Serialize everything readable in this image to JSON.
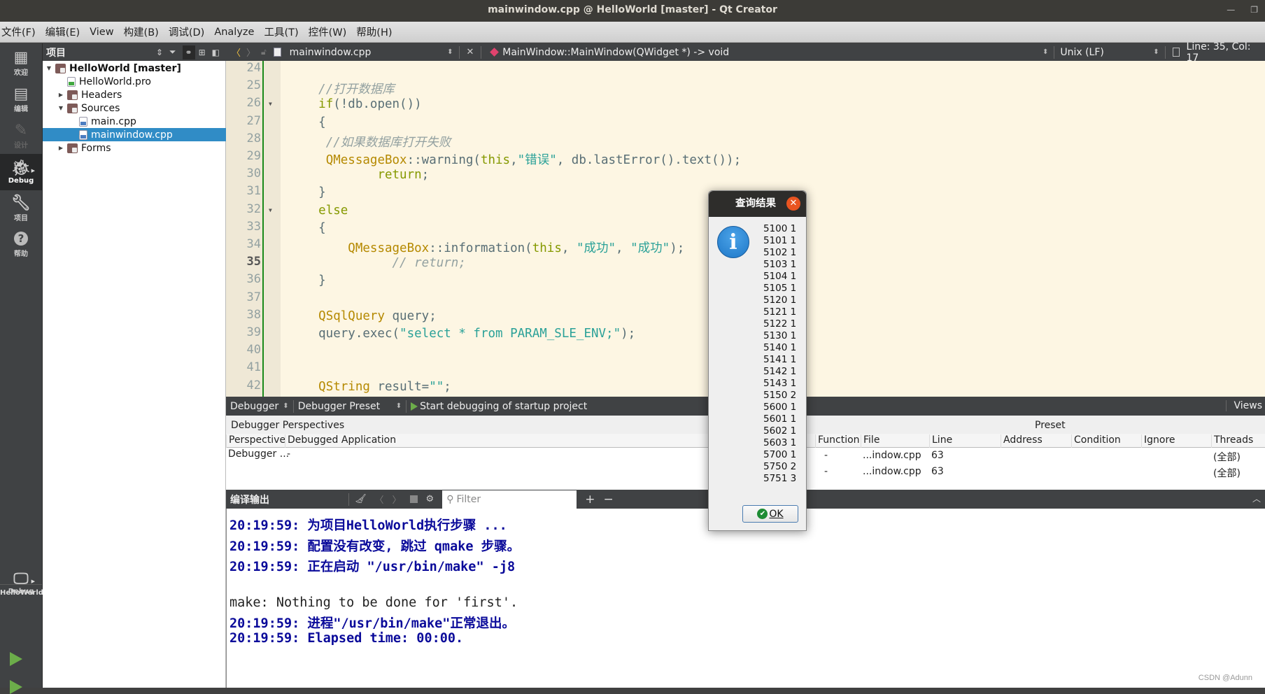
{
  "window": {
    "title": "mainwindow.cpp @ HelloWorld [master] - Qt Creator",
    "minimize_icon": "minimize-icon",
    "restore_icon": "restore-icon"
  },
  "menubar": {
    "items": [
      {
        "label": "文件(F)"
      },
      {
        "label": "编辑(E)"
      },
      {
        "label": "View"
      },
      {
        "label": "构建(B)"
      },
      {
        "label": "调试(D)"
      },
      {
        "label": "Analyze"
      },
      {
        "label": "工具(T)"
      },
      {
        "label": "控件(W)"
      },
      {
        "label": "帮助(H)"
      }
    ]
  },
  "modebar": {
    "modes": [
      {
        "label": "欢迎",
        "icon": "grid-icon",
        "state": "normal"
      },
      {
        "label": "编辑",
        "icon": "edit-doc-icon",
        "state": "normal"
      },
      {
        "label": "设计",
        "icon": "pencil-icon",
        "state": "disabled"
      },
      {
        "label": "Debug",
        "icon": "bug-icon",
        "state": "active"
      },
      {
        "label": "项目",
        "icon": "wrench-icon",
        "state": "normal"
      },
      {
        "label": "帮助",
        "icon": "help-icon",
        "state": "normal"
      }
    ],
    "kit_project": "HelloWorld",
    "kit_config": "Debug"
  },
  "project_panel": {
    "title": "项目",
    "tree": [
      {
        "label": "HelloWorld [master]",
        "level": 0,
        "expanded": true,
        "type": "project",
        "bold": true
      },
      {
        "label": "HelloWorld.pro",
        "level": 1,
        "type": "pro-file"
      },
      {
        "label": "Headers",
        "level": 1,
        "expanded": false,
        "type": "folder"
      },
      {
        "label": "Sources",
        "level": 1,
        "expanded": true,
        "type": "folder"
      },
      {
        "label": "main.cpp",
        "level": 2,
        "type": "cpp-file"
      },
      {
        "label": "mainwindow.cpp",
        "level": 2,
        "type": "cpp-file",
        "selected": true
      },
      {
        "label": "Forms",
        "level": 1,
        "expanded": false,
        "type": "folder"
      }
    ]
  },
  "editor_toolbar": {
    "file": "mainwindow.cpp",
    "function": "MainWindow::MainWindow(QWidget *) -> void",
    "line_ending": "Unix (LF)",
    "cursor": "Line: 35, Col: 17"
  },
  "editor": {
    "current_line": 35,
    "lines": [
      {
        "n": "24",
        "html": ""
      },
      {
        "n": "25",
        "html": "    <span class='c-cm'>//打开数据库</span>"
      },
      {
        "n": "26",
        "html": "    <span class='c-kw'>if</span>(!db.open())",
        "fold": true
      },
      {
        "n": "27",
        "html": "    {"
      },
      {
        "n": "28",
        "html": "     <span class='c-cm'>//如果数据库打开失败</span>"
      },
      {
        "n": "29",
        "html": "     <span class='c-ty'>QMessageBox</span>::warning(<span class='c-kw'>this</span>,<span class='c-st'>\"错误\"</span>, db.lastError().text());"
      },
      {
        "n": "30",
        "html": "            <span class='c-kw'>return</span>;"
      },
      {
        "n": "31",
        "html": "    }"
      },
      {
        "n": "32",
        "html": "    <span class='c-kw'>else</span>",
        "fold": true
      },
      {
        "n": "33",
        "html": "    {"
      },
      {
        "n": "34",
        "html": "        <span class='c-ty'>QMessageBox</span>::information(<span class='c-kw'>this</span>, <span class='c-st'>\"成功\"</span>, <span class='c-st'>\"成功\"</span>);"
      },
      {
        "n": "35",
        "html": "              <span class='c-cm'>// return;</span>"
      },
      {
        "n": "36",
        "html": "    }"
      },
      {
        "n": "37",
        "html": ""
      },
      {
        "n": "38",
        "html": "    <span class='c-ty'>QSqlQuery</span> query;"
      },
      {
        "n": "39",
        "html": "    query.exec(<span class='c-st'>\"select * from PARAM_SLE_ENV;\"</span>);"
      },
      {
        "n": "40",
        "html": ""
      },
      {
        "n": "41",
        "html": ""
      },
      {
        "n": "42",
        "html": "    <span class='c-ty'>QString</span> result=<span class='c-st'>\"\"</span>;"
      }
    ]
  },
  "debugger_toolbar": {
    "combo1": "Debugger",
    "combo2": "Debugger Preset",
    "start_label": "Start debugging of startup project",
    "views_label": "Views"
  },
  "perspectives": {
    "title": "Debugger Perspectives",
    "columns": [
      "Perspective",
      "Debugged Application"
    ],
    "rows": [
      [
        "Debugger ...",
        "-"
      ]
    ]
  },
  "breakpoints": {
    "title_fragment": "Preset",
    "columns": [
      "Function",
      "File",
      "Line",
      "Address",
      "Condition",
      "Ignore",
      "Threads"
    ],
    "rows": [
      [
        "-",
        "...indow.cpp",
        "63",
        "",
        "",
        "",
        "(全部)"
      ],
      [
        "-",
        "...indow.cpp",
        "63",
        "",
        "",
        "",
        "(全部)"
      ]
    ]
  },
  "output_pane": {
    "title": "编译输出",
    "filter_placeholder": "Filter",
    "lines": [
      {
        "text": "20:19:59: 为项目HelloWorld执行步骤 ...",
        "kind": "msg"
      },
      {
        "text": "20:19:59: 配置没有改变, 跳过 qmake 步骤。",
        "kind": "msg"
      },
      {
        "text": "20:19:59: 正在启动 \"/usr/bin/make\" -j8",
        "kind": "msg"
      },
      {
        "text": "",
        "kind": "plain"
      },
      {
        "text": "make: Nothing to be done for 'first'.",
        "kind": "plain"
      },
      {
        "text": "20:19:59: 进程\"/usr/bin/make\"正常退出。",
        "kind": "msg"
      },
      {
        "text": "20:19:59: Elapsed time: 00:00.",
        "kind": "msg"
      }
    ]
  },
  "dialog": {
    "title": "查询结果",
    "icon": "information-icon",
    "rows": [
      "5100 1",
      "5101 1",
      "5102 1",
      "5103 1",
      "5104 1",
      "5105 1",
      "5120 1",
      "5121 1",
      "5122 1",
      "5130 1",
      "5140 1",
      "5141 1",
      "5142 1",
      "5143 1",
      "5150 2",
      "5600 1",
      "5601 1",
      "5602 1",
      "5603 1",
      "5700 1",
      "5750 2",
      "5751 3"
    ],
    "ok_label": "OK"
  },
  "watermark": "CSDN @Adunn"
}
